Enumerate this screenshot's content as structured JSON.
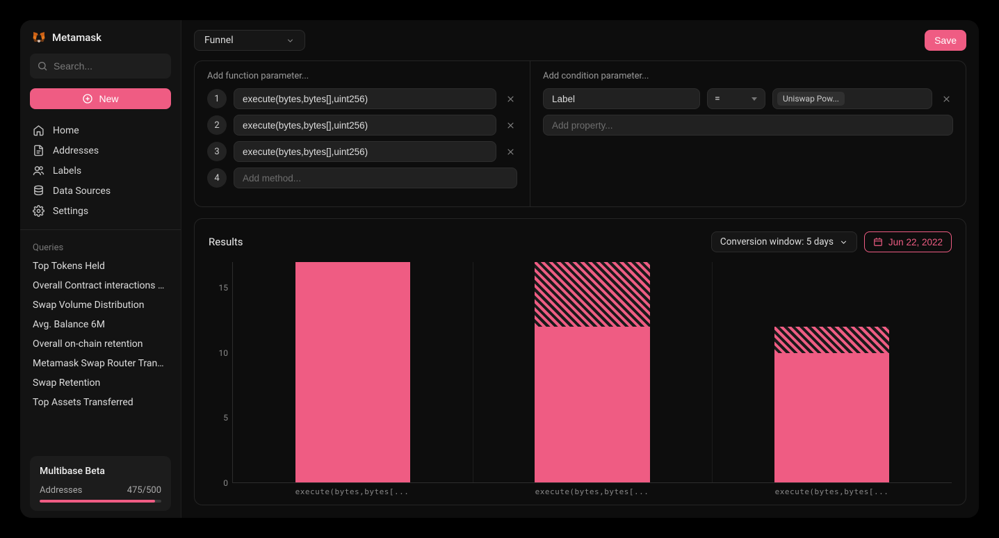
{
  "brand": {
    "name": "Metamask"
  },
  "search": {
    "placeholder": "Search..."
  },
  "new_button": "New",
  "nav": {
    "home": "Home",
    "addresses": "Addresses",
    "labels": "Labels",
    "data_sources": "Data Sources",
    "settings": "Settings"
  },
  "queries_section_label": "Queries",
  "queries": [
    "Top Tokens Held",
    "Overall Contract interactions Le...",
    "Swap Volume Distribution",
    "Avg. Balance 6M",
    "Overall on-chain retention",
    "Metamask Swap Router Transa...",
    "Swap Retention",
    "Top Assets Transferred"
  ],
  "beta": {
    "title": "Multibase Beta",
    "addresses_label": "Addresses",
    "addresses_value": "475/500",
    "fill_pct": 95
  },
  "topbar": {
    "type_select": "Funnel",
    "save": "Save"
  },
  "function_params": {
    "label": "Add function parameter...",
    "methods": [
      "execute(bytes,bytes[],uint256)",
      "execute(bytes,bytes[],uint256)",
      "execute(bytes,bytes[],uint256)"
    ],
    "add_placeholder": "Add method...",
    "next_index": "4"
  },
  "condition_params": {
    "label": "Add condition parameter...",
    "property": "Label",
    "operator": "=",
    "value_tag": "Uniswap Pow...",
    "add_placeholder": "Add property..."
  },
  "results": {
    "title": "Results",
    "conversion_window": "Conversion window: 5 days",
    "date": "Jun 22, 2022"
  },
  "chart_data": {
    "type": "bar",
    "title": "Results",
    "ylabel": "",
    "xlabel": "",
    "ylim": [
      0,
      17
    ],
    "y_ticks": [
      0,
      5,
      10,
      15
    ],
    "categories": [
      "execute(bytes,bytes[...",
      "execute(bytes,bytes[...",
      "execute(bytes,bytes[..."
    ],
    "series": [
      {
        "name": "converted",
        "values": [
          17,
          12,
          10
        ]
      },
      {
        "name": "drop_off",
        "values": [
          0,
          5,
          2
        ]
      }
    ]
  }
}
